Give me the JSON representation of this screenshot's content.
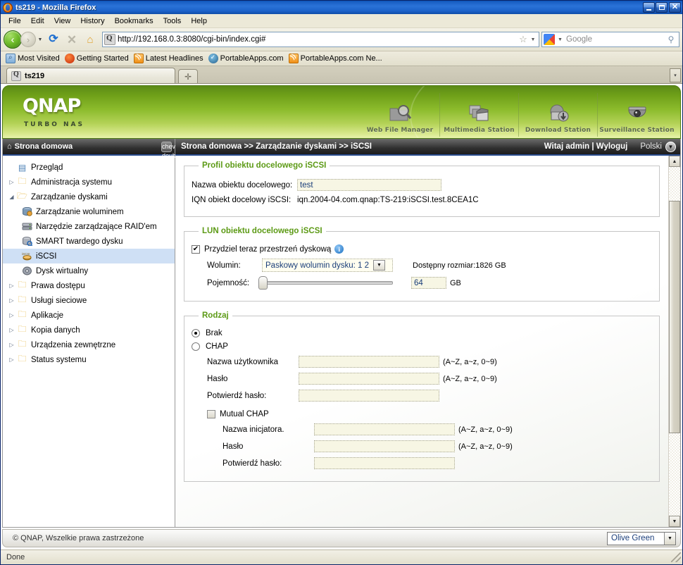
{
  "browser": {
    "title": "ts219 - Mozilla Firefox",
    "window_buttons": {
      "minimize": "_",
      "maximize": "□",
      "close": "✕"
    },
    "menus": [
      "File",
      "Edit",
      "View",
      "History",
      "Bookmarks",
      "Tools",
      "Help"
    ],
    "toolbar": {
      "back": "‹",
      "forward": "›",
      "dropdown": "▼",
      "reload": "⟳",
      "stop": "✕",
      "home": "⌂"
    },
    "url": "http://192.168.0.3:8080/cgi-bin/index.cgi#",
    "url_star": "☆",
    "search_engine": "Google",
    "search_placeholder": "Google",
    "bookmarks": [
      {
        "label": "Most Visited",
        "icon": "folder-icon"
      },
      {
        "label": "Getting Started",
        "icon": "firefox-icon"
      },
      {
        "label": "Latest Headlines",
        "icon": "rss-icon"
      },
      {
        "label": "PortableApps.com",
        "icon": "portableapps-icon"
      },
      {
        "label": "PortableApps.com Ne...",
        "icon": "rss-icon"
      }
    ],
    "tab": {
      "label": "ts219",
      "new_tab": "✛",
      "list_all": "▾"
    },
    "status": "Done"
  },
  "banner": {
    "logo": "QNAP",
    "tagline": "TURBO NAS",
    "apps": [
      {
        "label": "Web File Manager",
        "icon": "magnifier-folder-icon",
        "glyph": "🔍"
      },
      {
        "label": "Multimedia Station",
        "icon": "film-photos-icon",
        "glyph": "🎞"
      },
      {
        "label": "Download Station",
        "icon": "download-icon",
        "glyph": "⬇"
      },
      {
        "label": "Surveillance Station",
        "icon": "camera-dome-icon",
        "glyph": "◉"
      }
    ]
  },
  "sidebar": {
    "title": "Strona domowa",
    "home_icon": "home-icon",
    "collapse_icon": "chevron-double-left-icon",
    "items": [
      {
        "label": "Przegląd",
        "level": 1,
        "twisty": "",
        "icon": "document-icon",
        "selected": false
      },
      {
        "label": "Administracja systemu",
        "level": 1,
        "twisty": "▷",
        "icon": "folder-icon",
        "selected": false
      },
      {
        "label": "Zarządzanie dyskami",
        "level": 1,
        "twisty": "◢",
        "icon": "folder-open-icon",
        "selected": false
      },
      {
        "label": "Zarządzanie woluminem",
        "level": 2,
        "twisty": "",
        "icon": "volume-icon",
        "selected": false
      },
      {
        "label": "Narzędzie zarządzające RAID'em",
        "level": 2,
        "twisty": "",
        "icon": "raid-icon",
        "selected": false
      },
      {
        "label": "SMART twardego dysku",
        "level": 2,
        "twisty": "",
        "icon": "smart-icon",
        "selected": false
      },
      {
        "label": "iSCSI",
        "level": 2,
        "twisty": "",
        "icon": "iscsi-icon",
        "selected": true
      },
      {
        "label": "Dysk wirtualny",
        "level": 2,
        "twisty": "",
        "icon": "vdisk-icon",
        "selected": false
      },
      {
        "label": "Prawa dostępu",
        "level": 1,
        "twisty": "▷",
        "icon": "folder-icon",
        "selected": false
      },
      {
        "label": "Usługi sieciowe",
        "level": 1,
        "twisty": "▷",
        "icon": "folder-icon",
        "selected": false
      },
      {
        "label": "Aplikacje",
        "level": 1,
        "twisty": "▷",
        "icon": "folder-icon",
        "selected": false
      },
      {
        "label": "Kopia danych",
        "level": 1,
        "twisty": "▷",
        "icon": "folder-icon",
        "selected": false
      },
      {
        "label": "Urządzenia zewnętrzne",
        "level": 1,
        "twisty": "▷",
        "icon": "folder-icon",
        "selected": false
      },
      {
        "label": "Status systemu",
        "level": 1,
        "twisty": "▷",
        "icon": "folder-icon",
        "selected": false
      }
    ]
  },
  "header": {
    "breadcrumb": "Strona domowa >> Zarządzanie dyskami >> iSCSI",
    "greeting": "Witaj admin | Wyloguj",
    "language": "Polski",
    "language_caret": "▼"
  },
  "main": {
    "profile": {
      "legend": "Profil obiektu docelowego iSCSI",
      "name_label": "Nazwa obiektu docelowego:",
      "name_value": "test",
      "iqn_label": "IQN obiekt docelowy iSCSI:",
      "iqn_value": "iqn.2004-04.com.qnap:TS-219:iSCSI.test.8CEA1C"
    },
    "lun": {
      "legend": "LUN obiektu docelowego iSCSI",
      "allocate_label": "Przydziel teraz przestrzeń dyskową",
      "allocate_checked": true,
      "allocate_mark": "✔",
      "info_icon": "info-icon",
      "info_glyph": "i",
      "volume_label": "Wolumin:",
      "volume_value": "Paskowy wolumin dysku: 1 2",
      "volume_caret": "▼",
      "available_size": "Dostępny rozmiar:1826 GB",
      "capacity_label": "Pojemność:",
      "capacity_value": "64",
      "capacity_unit": "GB",
      "capacity_slider_percent": 2
    },
    "auth": {
      "legend": "Rodzaj",
      "option_none": "Brak",
      "option_none_selected": true,
      "option_chap": "CHAP",
      "option_chap_selected": false,
      "username_label": "Nazwa użytkownika",
      "username_value": "",
      "username_hint": "(A~Z, a~z, 0~9)",
      "password_label": "Hasło",
      "password_value": "",
      "password_hint": "(A~Z, a~z, 0~9)",
      "confirm_label": "Potwierdź hasło:",
      "confirm_value": "",
      "mutual_label": "Mutual CHAP",
      "mutual_checked": false,
      "initiator_label": "Nazwa inicjatora.",
      "initiator_value": "",
      "initiator_hint": "(A~Z, a~z, 0~9)",
      "mutual_password_label": "Hasło",
      "mutual_password_value": "",
      "mutual_password_hint": "(A~Z, a~z, 0~9)",
      "mutual_confirm_label": "Potwierdź hasło:",
      "mutual_confirm_value": ""
    },
    "scrollbar": {
      "up": "▲",
      "down": "▼"
    }
  },
  "footer": {
    "copyright": "© QNAP, Wszelkie prawa zastrzeżone",
    "theme": "Olive Green",
    "theme_caret": "▼"
  },
  "colors": {
    "brand_green": "#8cbb2c",
    "legend_green": "#5c9a15",
    "titlebar_blue": "#2a72d8",
    "selected_row": "#cfe0f5",
    "field_bg": "#f7f6e4",
    "field_text": "#1a3e7a"
  }
}
